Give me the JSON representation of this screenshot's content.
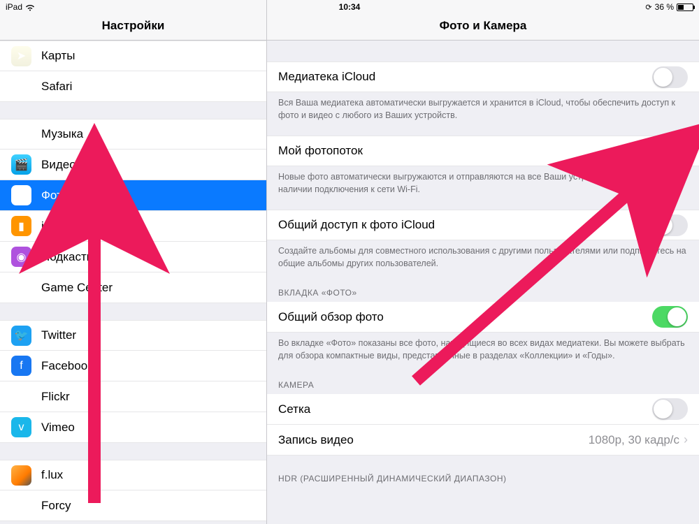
{
  "status": {
    "device": "iPad",
    "time": "10:34",
    "battery": "36 %",
    "lock_icon": "⟳"
  },
  "sidebar": {
    "title": "Настройки",
    "groups": [
      [
        {
          "id": "maps",
          "label": "Карты",
          "icon": "icn-maps",
          "glyph": "➤"
        },
        {
          "id": "safari",
          "label": "Safari",
          "icon": "icn-safari",
          "glyph": "✷"
        }
      ],
      [
        {
          "id": "music",
          "label": "Музыка",
          "icon": "icn-music",
          "glyph": "♫"
        },
        {
          "id": "video",
          "label": "Видео",
          "icon": "icn-video",
          "glyph": "🎬"
        },
        {
          "id": "photos",
          "label": "Фото и Камера",
          "icon": "icn-photos",
          "glyph": "✿",
          "selected": true
        },
        {
          "id": "ibooks",
          "label": "iBooks",
          "icon": "icn-ibooks",
          "glyph": "▮"
        },
        {
          "id": "podcasts",
          "label": "Подкасты",
          "icon": "icn-podcasts",
          "glyph": "◉"
        },
        {
          "id": "gamecenter",
          "label": "Game Center",
          "icon": "icn-gamecenter",
          "glyph": "●"
        }
      ],
      [
        {
          "id": "twitter",
          "label": "Twitter",
          "icon": "icn-twitter",
          "glyph": "🐦"
        },
        {
          "id": "facebook",
          "label": "Facebook",
          "icon": "icn-facebook",
          "glyph": "f"
        },
        {
          "id": "flickr",
          "label": "Flickr",
          "icon": "icn-flickr",
          "glyph": "••"
        },
        {
          "id": "vimeo",
          "label": "Vimeo",
          "icon": "icn-vimeo",
          "glyph": "v"
        }
      ],
      [
        {
          "id": "flux",
          "label": "f.lux",
          "icon": "icn-flux",
          "glyph": ""
        },
        {
          "id": "forcy",
          "label": "Forcy",
          "icon": "icn-forcy",
          "glyph": ""
        }
      ]
    ]
  },
  "detail": {
    "title": "Фото и Камера",
    "sections": [
      {
        "rows": [
          {
            "id": "icloud-library",
            "label": "Медиатека iCloud",
            "type": "switch",
            "on": false
          }
        ],
        "footer": "Вся Ваша медиатека автоматически выгружается и хранится в iCloud, чтобы обеспечить доступ к фото и видео с любого из Ваших устройств."
      },
      {
        "rows": [
          {
            "id": "photo-stream",
            "label": "Мой фотопоток",
            "type": "switch",
            "on": false
          }
        ],
        "footer": "Новые фото автоматически выгружаются и отправляются на все Ваши устройства iCloud при наличии подключения к сети Wi-Fi."
      },
      {
        "rows": [
          {
            "id": "icloud-sharing",
            "label": "Общий доступ к фото iCloud",
            "type": "switch",
            "on": false
          }
        ],
        "footer": "Создайте альбомы для совместного использования с другими пользователями или подпишитесь на общие альбомы других пользователей."
      },
      {
        "header": "ВКЛАДКА «ФОТО»",
        "rows": [
          {
            "id": "summarize",
            "label": "Общий обзор фото",
            "type": "switch",
            "on": true
          }
        ],
        "footer": "Во вкладке «Фото» показаны все фото, находящиеся во всех видах медиатеки. Вы можете выбрать для обзора компактные виды, представленные в разделах «Коллекции» и «Годы»."
      },
      {
        "header": "КАМЕРА",
        "rows": [
          {
            "id": "grid",
            "label": "Сетка",
            "type": "switch",
            "on": false
          },
          {
            "id": "record-video",
            "label": "Запись видео",
            "type": "link",
            "value": "1080p, 30 кадр/с"
          }
        ]
      },
      {
        "header": "HDR (РАСШИРЕННЫЙ ДИНАМИЧЕСКИЙ ДИАПАЗОН)",
        "rows": []
      }
    ]
  },
  "annotation": {
    "color": "#ec1a5b"
  }
}
